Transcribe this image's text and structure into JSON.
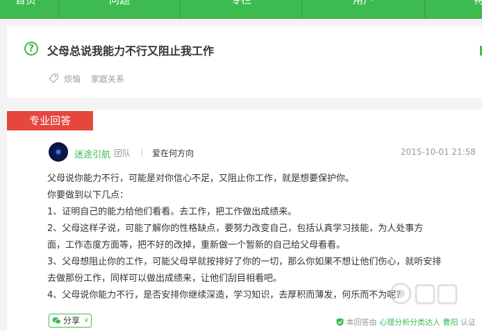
{
  "nav": {
    "items": [
      "首页",
      "问题",
      "专栏",
      "用户",
      "特"
    ]
  },
  "question": {
    "title": "父母总说我能力不行又阻止我工作",
    "tags": [
      "烦恼",
      "家庭关系"
    ]
  },
  "answer": {
    "badge": "专业回答",
    "author": "迷途引航",
    "team": "团队",
    "motto": "爱在何方向",
    "date": "2015-10-01 21:58",
    "paragraphs": [
      "父母说你能力不行，可能是对你信心不足，又阻止你工作，就是想要保护你。",
      "你要做到以下几点：",
      "1、证明自己的能力给他们看看。去工作，把工作做出成绩来。",
      "2、父母这样子说，可能了解你的性格缺点，要努力改变自己，包括认真学习技能，为人处事方",
      "面，工作态度方面等，把不好的改掉，重新做一个暂新的自己给父母看看。",
      "3、父母想阻止你的工作，可能父母早就按排好了你的一切，那么你如果不想让他们伤心，就听安排",
      "去做那份工作，同样可以做出成绩来，让他们刮目相看吧。",
      "4、父母说你能力不行，是否安排你继续深造，学习知识，去厚积而薄发，何乐而不为呢？"
    ],
    "share_label": "分享",
    "cert_prefix": "本回答由",
    "cert_org": "心理分析分类达人",
    "cert_name": "曹阳",
    "cert_suffix": "认证"
  },
  "colors": {
    "brand_green": "#3dbb50",
    "badge_red": "#e5473f"
  }
}
